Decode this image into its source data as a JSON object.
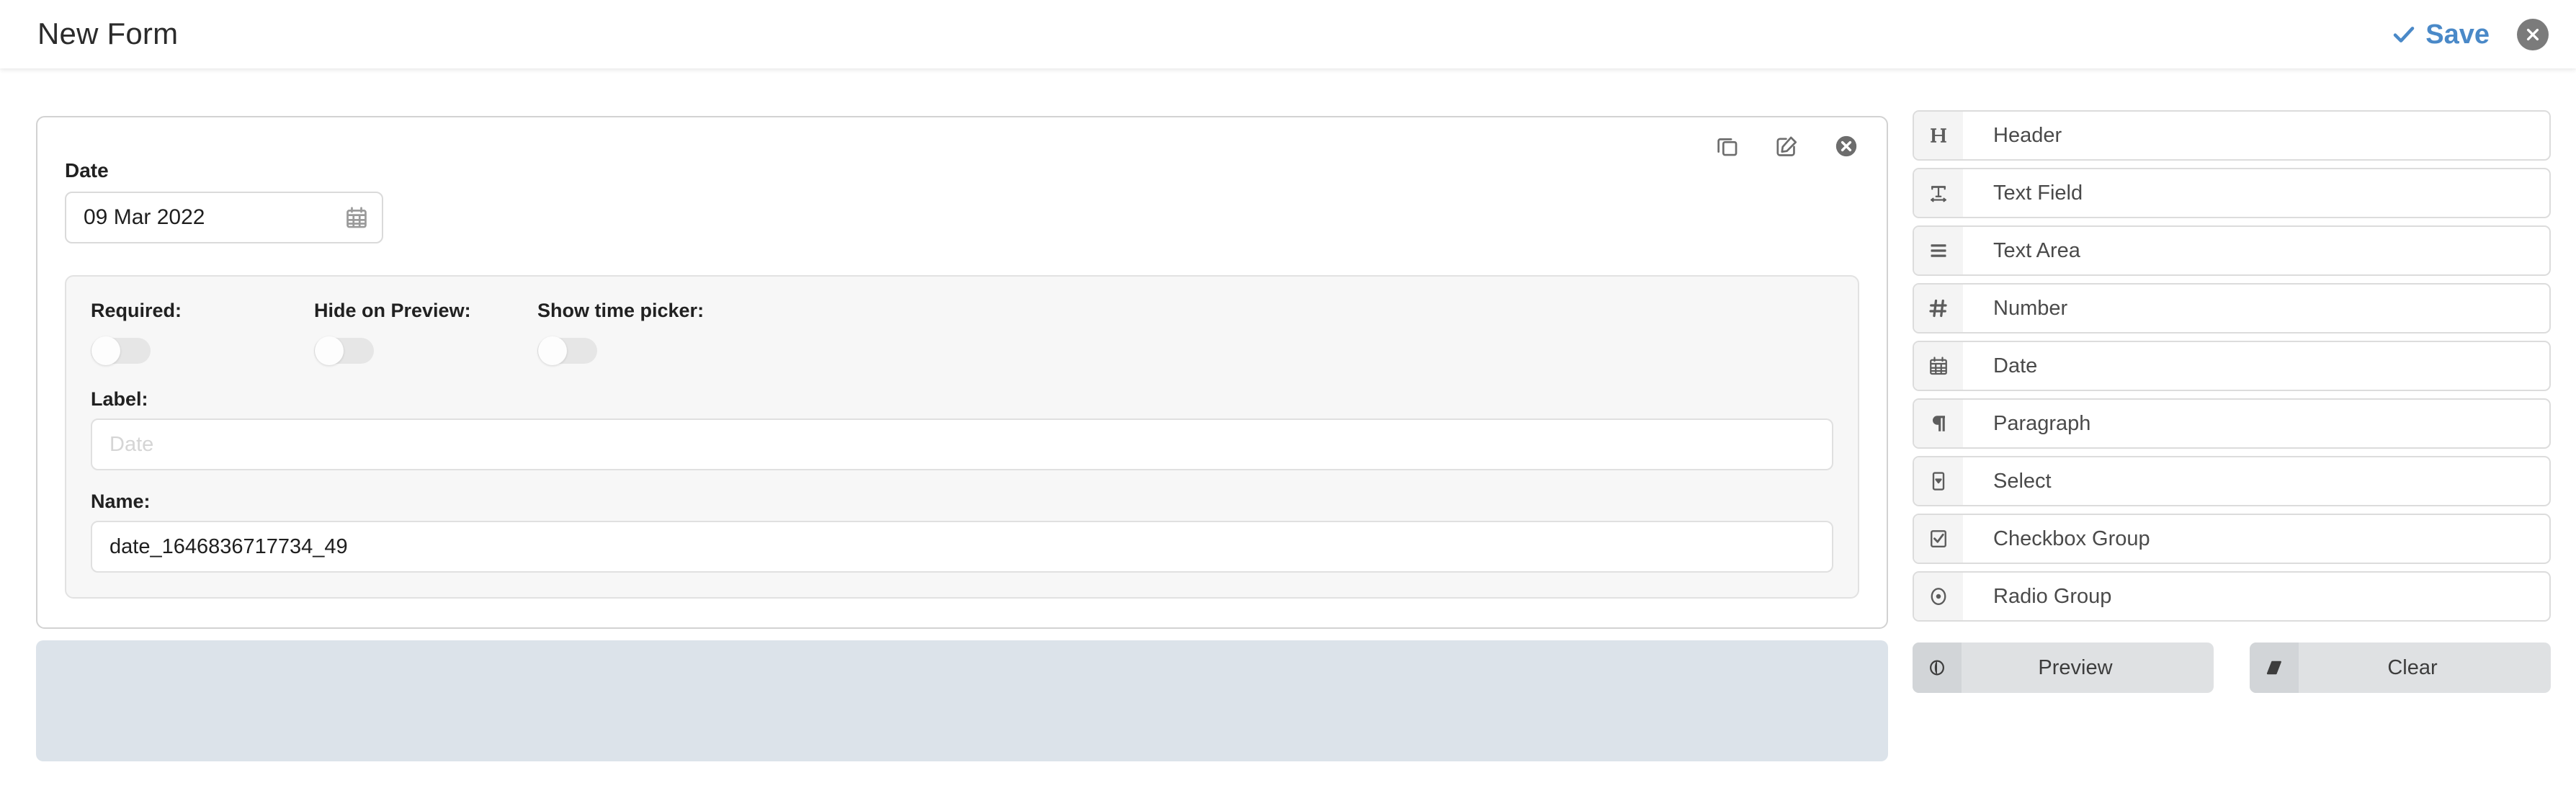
{
  "topbar": {
    "title": "New Form",
    "save_label": "Save",
    "save_icon": "check-icon",
    "close_icon": "close-circle-icon",
    "accent_color": "#4a89c8",
    "close_bg_color": "#7b7b7b"
  },
  "field_card": {
    "tools": [
      {
        "name": "duplicate",
        "icon": "copy-icon"
      },
      {
        "name": "edit",
        "icon": "edit-pencil-icon"
      },
      {
        "name": "remove",
        "icon": "close-circle-icon"
      }
    ],
    "preview": {
      "label": "Date",
      "value": "09 Mar 2022",
      "calendar_icon": "calendar-icon"
    },
    "settings": {
      "toggles": [
        {
          "label": "Required:",
          "state": "off"
        },
        {
          "label": "Hide on Preview:",
          "state": "off"
        },
        {
          "label": "Show time picker:",
          "state": "off"
        }
      ],
      "fields": [
        {
          "label": "Label:",
          "value": "",
          "placeholder": "Date"
        },
        {
          "label": "Name:",
          "value": "date_1646836717734_49",
          "placeholder": ""
        }
      ]
    }
  },
  "drop_zone": {
    "color": "#dce3ea"
  },
  "palette": {
    "items": [
      {
        "label": "Header",
        "icon": "heading-h-icon"
      },
      {
        "label": "Text Field",
        "icon": "text-field-icon"
      },
      {
        "label": "Text Area",
        "icon": "text-area-lines-icon"
      },
      {
        "label": "Number",
        "icon": "number-hash-icon"
      },
      {
        "label": "Date",
        "icon": "calendar-icon"
      },
      {
        "label": "Paragraph",
        "icon": "paragraph-pilcrow-icon"
      },
      {
        "label": "Select",
        "icon": "select-dropdown-icon"
      },
      {
        "label": "Checkbox Group",
        "icon": "checkbox-checked-icon"
      },
      {
        "label": "Radio Group",
        "icon": "radio-dot-icon"
      }
    ],
    "actions": [
      {
        "label": "Preview",
        "icon": "eye-icon"
      },
      {
        "label": "Clear",
        "icon": "eraser-icon"
      }
    ]
  }
}
